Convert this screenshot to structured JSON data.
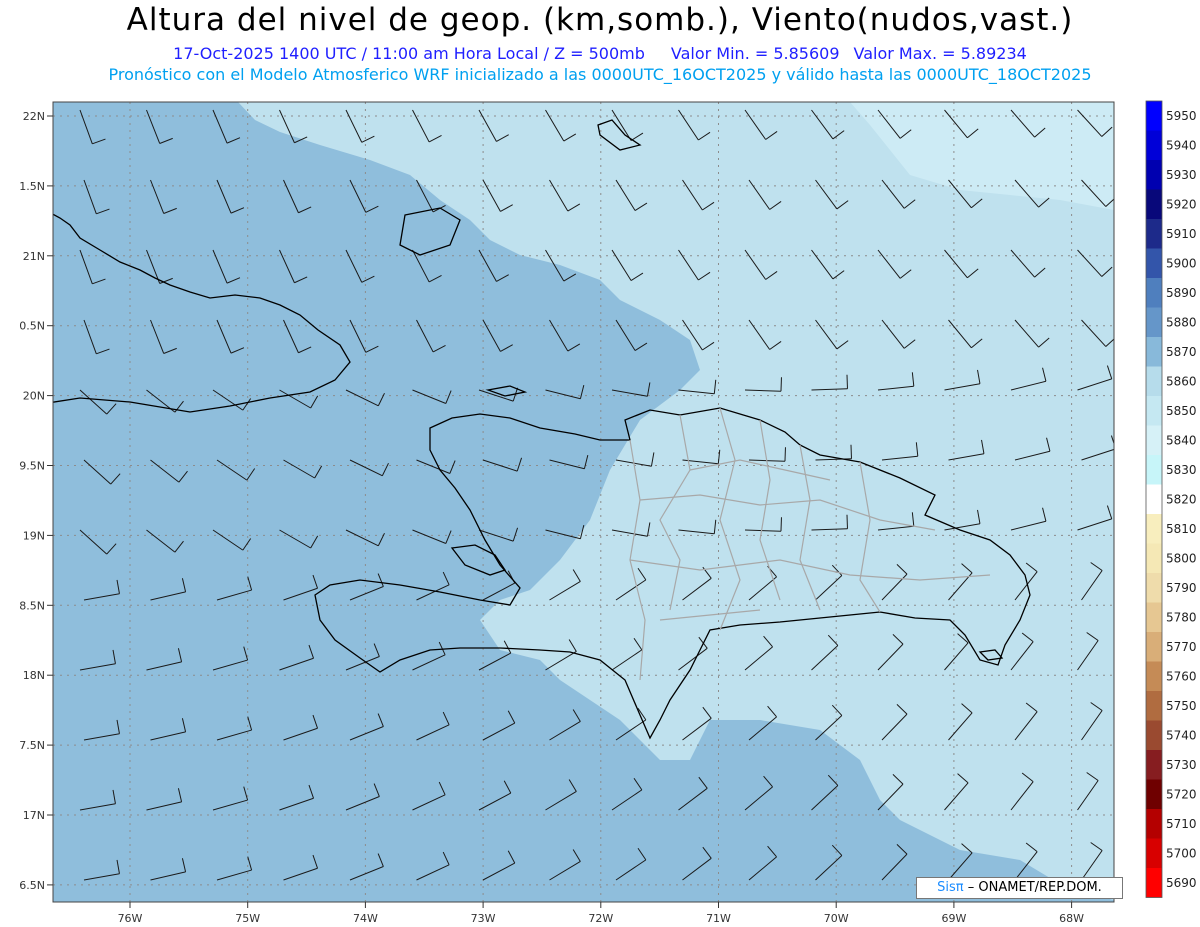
{
  "header": {
    "title": "Altura del nivel de geop. (km,somb.), Viento(nudos,vast.)",
    "line1_date": "17-Oct-2025  1400 UTC / 11:00 am Hora Local / Z = 500mb",
    "line1_min": "Valor Min. = 5.85609",
    "line1_max": "Valor Max. = 5.89234",
    "line2": "Pronóstico con el Modelo Atmosferico WRF inicializado a las 0000UTC_16OCT2025 y válido hasta las  0000UTC_18OCT2025"
  },
  "map": {
    "lat_labels": [
      "22N",
      "1.5N",
      "21N",
      "0.5N",
      "20N",
      "9.5N",
      "19N",
      "8.5N",
      "18N",
      "7.5N",
      "17N",
      "6.5N"
    ],
    "lon_labels": [
      "76W",
      "75W",
      "74W",
      "73W",
      "72W",
      "71W",
      "70W",
      "69W",
      "68W"
    ],
    "wind_barb_color": "#1a1a1a",
    "coastline_color": "#000000",
    "province_border_color": "#a8a8a8",
    "gridline_color": "#909090"
  },
  "colorbar": {
    "labels": [
      "5950",
      "5940",
      "5930",
      "5920",
      "5910",
      "5900",
      "5890",
      "5880",
      "5870",
      "5860",
      "5850",
      "5840",
      "5830",
      "5820",
      "5810",
      "5800",
      "5790",
      "5780",
      "5770",
      "5760",
      "5750",
      "5740",
      "5730",
      "5720",
      "5710",
      "5700",
      "5690"
    ],
    "colors": [
      "#0000ff",
      "#0000d8",
      "#0000b0",
      "#08087a",
      "#1d2a8a",
      "#3355aa",
      "#4f7fbe",
      "#6596c9",
      "#88b9da",
      "#b6dceb",
      "#c5e8f2",
      "#d6f1f7",
      "#c7f5f9",
      "#ffffff",
      "#f8eebe",
      "#f5e8b5",
      "#efdcab",
      "#e6c792",
      "#d9ae78",
      "#c58b56",
      "#b06c40",
      "#9a4a30",
      "#861d20",
      "#6f0000",
      "#b40000",
      "#d80000",
      "#ff0000"
    ]
  },
  "credit": {
    "sis": "Sisπ",
    "org": "– ONAMET/REP.DOM."
  }
}
